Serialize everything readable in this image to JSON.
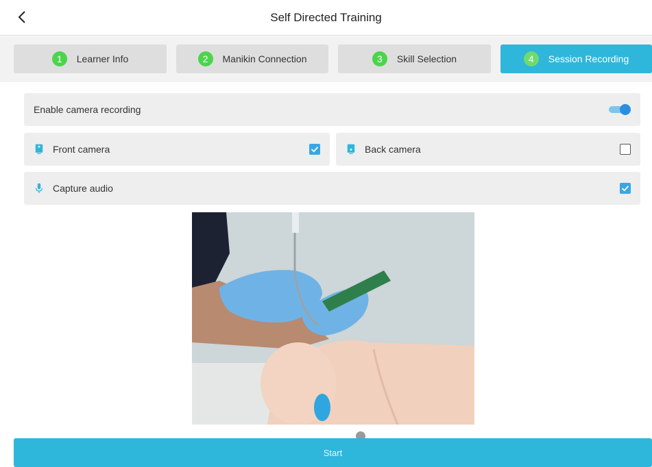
{
  "header": {
    "title": "Self Directed Training",
    "back_icon": "chevron-left-icon"
  },
  "steps": [
    {
      "num": "1",
      "label": "Learner Info",
      "active": false
    },
    {
      "num": "2",
      "label": "Manikin Connection",
      "active": false
    },
    {
      "num": "3",
      "label": "Skill Selection",
      "active": false
    },
    {
      "num": "4",
      "label": "Session Recording",
      "active": true
    }
  ],
  "options": {
    "enable_camera": {
      "label": "Enable camera recording",
      "enabled": true
    },
    "front_camera": {
      "label": "Front camera",
      "icon": "front-camera-icon",
      "checked": true
    },
    "back_camera": {
      "label": "Back camera",
      "icon": "back-camera-icon",
      "checked": false
    },
    "capture_audio": {
      "label": "Capture audio",
      "icon": "microphone-icon",
      "checked": true
    }
  },
  "preview": {
    "description_icon": "camera-preview"
  },
  "footer": {
    "start_label": "Start"
  },
  "colors": {
    "accent": "#2fb6db",
    "step_number": "#4cd44c",
    "checkbox": "#3aa6e5",
    "toggle": "#2a8fe0"
  }
}
